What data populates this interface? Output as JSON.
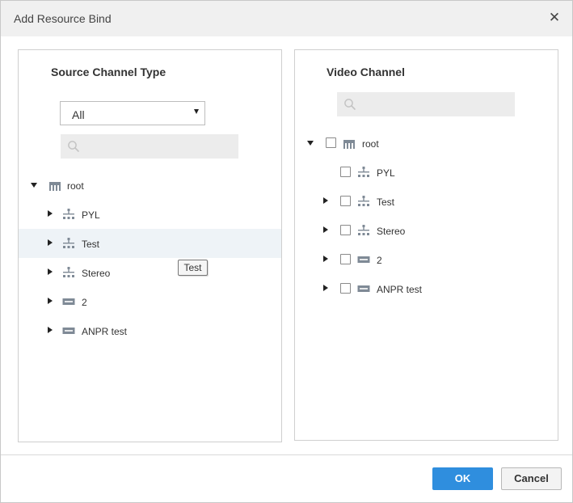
{
  "dialog": {
    "title": "Add Resource Bind",
    "close_symbol": "✕"
  },
  "left_panel": {
    "title": "Source Channel Type",
    "type_select": {
      "selected": "All"
    },
    "search": {
      "placeholder": ""
    },
    "tree": {
      "root": {
        "label": "root",
        "icon": "org-root-icon",
        "expanded": true
      },
      "children": [
        {
          "label": "PYL",
          "icon": "org-node-icon"
        },
        {
          "label": "Test",
          "icon": "org-node-icon",
          "hovered": true
        },
        {
          "label": "Stereo",
          "icon": "org-node-icon"
        },
        {
          "label": "2",
          "icon": "device-icon"
        },
        {
          "label": "ANPR test",
          "icon": "device-icon"
        }
      ]
    },
    "tooltip": "Test"
  },
  "right_panel": {
    "title": "Video Channel",
    "search": {
      "placeholder": ""
    },
    "tree": {
      "root": {
        "label": "root",
        "icon": "org-root-icon",
        "expanded": true,
        "checked": false
      },
      "children": [
        {
          "label": "PYL",
          "icon": "org-node-icon",
          "has_children": false,
          "checked": false
        },
        {
          "label": "Test",
          "icon": "org-node-icon",
          "has_children": true,
          "checked": false
        },
        {
          "label": "Stereo",
          "icon": "org-node-icon",
          "has_children": true,
          "checked": false
        },
        {
          "label": "2",
          "icon": "device-icon",
          "has_children": true,
          "checked": false
        },
        {
          "label": "ANPR test",
          "icon": "device-icon",
          "has_children": true,
          "checked": false
        }
      ]
    }
  },
  "footer": {
    "ok_label": "OK",
    "cancel_label": "Cancel"
  },
  "colors": {
    "accent": "#2f8ede",
    "icon_gray": "#7f8a96",
    "hover_row": "#eef3f7"
  }
}
